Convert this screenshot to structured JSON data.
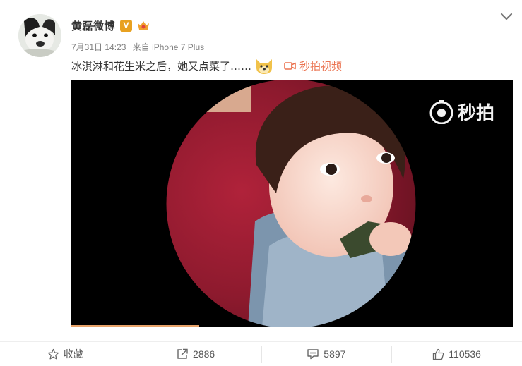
{
  "post": {
    "username": "黄磊微博",
    "verified_badge": "V",
    "time": "7月31日 14:23",
    "source": "来自 iPhone 7 Plus",
    "text": "冰淇淋和花生米之后，她又点菜了……",
    "video_link_label": "秒拍视频"
  },
  "video": {
    "watermark": "秒拍",
    "progress_fraction": 0.29
  },
  "actions": {
    "favorite": "收藏",
    "repost": "2886",
    "comment": "5897",
    "like": "110536"
  },
  "colors": {
    "link": "#eb7350",
    "verified": "#e8a120",
    "video_bg": "#000000",
    "progress": "#e8a36a"
  },
  "icons": [
    "chevron-down-icon",
    "verified-icon",
    "member-crown-icon",
    "doge-emoji-icon",
    "video-camera-icon",
    "miaopai-camera-icon",
    "star-icon",
    "share-icon",
    "comment-icon",
    "thumbs-up-icon"
  ]
}
